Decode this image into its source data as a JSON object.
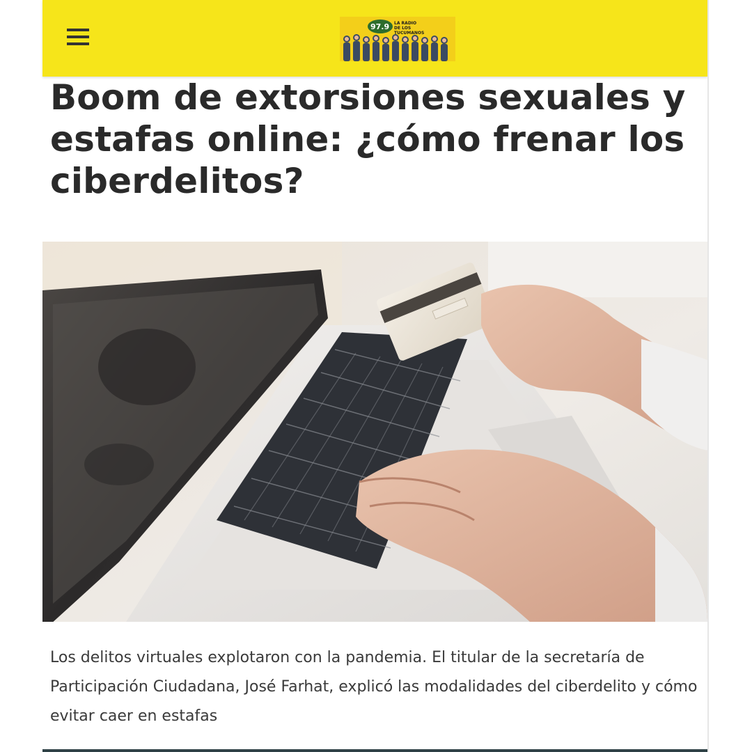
{
  "header": {
    "menu_icon": "hamburger-menu-icon",
    "logo": {
      "text": "97.9 LA RADIO",
      "background": "#f6d51a"
    },
    "background": "#f6e51a"
  },
  "article": {
    "headline": "Boom de extorsiones sexuales y estafas online: ¿cómo frenar los ciberdelitos?",
    "image_description_icon": "laptop-credit-card-photo",
    "summary": "Los delitos virtuales explotaron con la pandemia. El titular de la secretaría de Participación Ciudadana, José Farhat, explicó las modalidades del ciberdelito y cómo evitar caer en estafas"
  }
}
